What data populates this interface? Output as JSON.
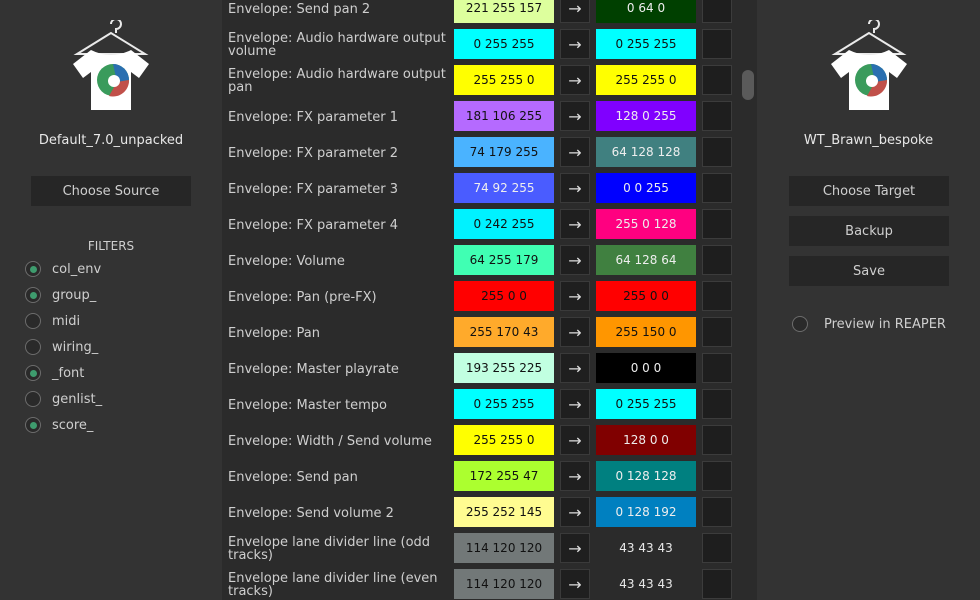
{
  "left": {
    "theme_name": "Default_7.0_unpacked",
    "choose_label": "Choose Source",
    "filters_title": "FILTERS",
    "filters": [
      {
        "label": "col_env",
        "checked": true
      },
      {
        "label": "group_",
        "checked": true
      },
      {
        "label": "midi",
        "checked": false
      },
      {
        "label": "wiring_",
        "checked": false
      },
      {
        "label": "_font",
        "checked": true
      },
      {
        "label": "genlist_",
        "checked": false
      },
      {
        "label": "score_",
        "checked": true
      }
    ]
  },
  "right": {
    "theme_name": "WT_Brawn_bespoke",
    "choose_label": "Choose Target",
    "backup_label": "Backup",
    "save_label": "Save",
    "preview_label": "Preview in REAPER",
    "preview_checked": false
  },
  "rows": [
    {
      "name": "Envelope: Send pan 2",
      "src": "221 255 157",
      "src_color": "#ddff9d",
      "src_text": "#111111",
      "dst": "0 64 0",
      "dst_color": "#004000",
      "dst_text": "#eeeeee"
    },
    {
      "name": "Envelope: Audio hardware output volume",
      "src": "0 255 255",
      "src_color": "#00ffff",
      "src_text": "#111111",
      "dst": "0 255 255",
      "dst_color": "#00ffff",
      "dst_text": "#111111"
    },
    {
      "name": "Envelope: Audio hardware output pan",
      "src": "255 255 0",
      "src_color": "#ffff00",
      "src_text": "#111111",
      "dst": "255 255 0",
      "dst_color": "#ffff00",
      "dst_text": "#111111"
    },
    {
      "name": "Envelope: FX parameter 1",
      "src": "181 106 255",
      "src_color": "#b56aff",
      "src_text": "#111111",
      "dst": "128 0 255",
      "dst_color": "#8000ff",
      "dst_text": "#eeeeee"
    },
    {
      "name": "Envelope: FX parameter 2",
      "src": "74 179 255",
      "src_color": "#4ab3ff",
      "src_text": "#111111",
      "dst": "64 128 128",
      "dst_color": "#408080",
      "dst_text": "#eeeeee"
    },
    {
      "name": "Envelope: FX parameter 3",
      "src": "74 92 255",
      "src_color": "#4a5cff",
      "src_text": "#eeeeee",
      "dst": "0 0 255",
      "dst_color": "#0000ff",
      "dst_text": "#eeeeee"
    },
    {
      "name": "Envelope: FX parameter 4",
      "src": "0 242 255",
      "src_color": "#00f2ff",
      "src_text": "#111111",
      "dst": "255 0 128",
      "dst_color": "#ff0080",
      "dst_text": "#eeeeee"
    },
    {
      "name": "Envelope: Volume",
      "src": "64 255 179",
      "src_color": "#40ffb3",
      "src_text": "#111111",
      "dst": "64 128 64",
      "dst_color": "#408040",
      "dst_text": "#eeeeee"
    },
    {
      "name": "Envelope: Pan (pre-FX)",
      "src": "255 0 0",
      "src_color": "#ff0000",
      "src_text": "#111111",
      "dst": "255 0 0",
      "dst_color": "#ff0000",
      "dst_text": "#111111"
    },
    {
      "name": "Envelope: Pan",
      "src": "255 170 43",
      "src_color": "#ffaa2b",
      "src_text": "#111111",
      "dst": "255 150 0",
      "dst_color": "#ff9600",
      "dst_text": "#111111"
    },
    {
      "name": "Envelope: Master playrate",
      "src": "193 255 225",
      "src_color": "#c1ffe1",
      "src_text": "#111111",
      "dst": "0 0 0",
      "dst_color": "#000000",
      "dst_text": "#eeeeee"
    },
    {
      "name": "Envelope: Master tempo",
      "src": "0 255 255",
      "src_color": "#00ffff",
      "src_text": "#111111",
      "dst": "0 255 255",
      "dst_color": "#00ffff",
      "dst_text": "#111111"
    },
    {
      "name": "Envelope: Width / Send volume",
      "src": "255 255 0",
      "src_color": "#ffff00",
      "src_text": "#111111",
      "dst": "128 0 0",
      "dst_color": "#800000",
      "dst_text": "#eeeeee"
    },
    {
      "name": "Envelope: Send pan",
      "src": "172 255 47",
      "src_color": "#acff2f",
      "src_text": "#111111",
      "dst": "0 128 128",
      "dst_color": "#008080",
      "dst_text": "#eeeeee"
    },
    {
      "name": "Envelope: Send volume 2",
      "src": "255 252 145",
      "src_color": "#fffc91",
      "src_text": "#111111",
      "dst": "0 128 192",
      "dst_color": "#0080c0",
      "dst_text": "#eeeeee"
    },
    {
      "name": "Envelope lane divider line (odd tracks)",
      "src": "114 120 120",
      "src_color": "#727878",
      "src_text": "#111111",
      "dst": "43 43 43",
      "dst_color": "#2b2b2b",
      "dst_text": "#e8e8e8"
    },
    {
      "name": "Envelope lane divider line (even tracks)",
      "src": "114 120 120",
      "src_color": "#727878",
      "src_text": "#111111",
      "dst": "43 43 43",
      "dst_color": "#2b2b2b",
      "dst_text": "#e8e8e8"
    }
  ]
}
